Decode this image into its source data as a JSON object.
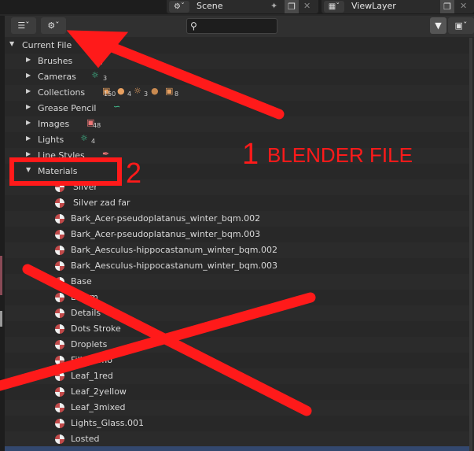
{
  "topbar": {
    "scene_label": "Scene",
    "viewlayer_label": "ViewLayer"
  },
  "header": {
    "display_mode_icon": "outliner-icon",
    "filter_icon": "funnel-icon",
    "search_placeholder": ""
  },
  "tree": {
    "root": "Current File",
    "categories": [
      {
        "label": "Brushes",
        "count": "77"
      },
      {
        "label": "Cameras",
        "count": "3"
      },
      {
        "label": "Collections",
        "counts": [
          "150",
          "4",
          "3",
          "8"
        ]
      },
      {
        "label": "Grease Pencil",
        "count": ""
      },
      {
        "label": "Images",
        "count": "48"
      },
      {
        "label": "Lights",
        "count": "4"
      },
      {
        "label": "Line Styles",
        "count": ""
      },
      {
        "label": "Materials",
        "count": ""
      }
    ],
    "materials": [
      "Silver",
      "Silver zad far",
      "Bark_Acer-pseudoplatanus_winter_bqm.002",
      "Bark_Acer-pseudoplatanus_winter_bqm.003",
      "Bark_Aesculus-hippocastanum_winter_bqm.002",
      "Bark_Aesculus-hippocastanum_winter_bqm.003",
      "Base",
      "Bloom",
      "Details",
      "Dots Stroke",
      "Droplets",
      "Fill Gizmo",
      "Leaf_1red",
      "Leaf_2yellow",
      "Leaf_3mixed",
      "Lights_Glass.001",
      "Losted"
    ]
  },
  "annotations": {
    "label_1": "1",
    "label_1_text": "BLENDER FILE",
    "label_2": "2",
    "color": "#ff1a1a"
  }
}
